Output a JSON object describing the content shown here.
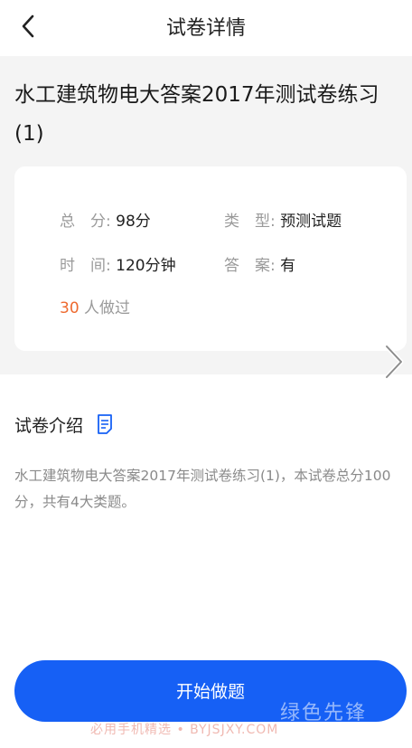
{
  "header": {
    "title": "试卷详情",
    "back_icon": "chevron-left-icon"
  },
  "exam": {
    "title": "水工建筑物电大答案2017年测试卷练习(1)"
  },
  "info": {
    "total_label": "总　分:",
    "total_value": "98分",
    "type_label": "类　型:",
    "type_value": "预测试题",
    "time_label": "时　间:",
    "time_value": "120分钟",
    "answer_label": "答　案:",
    "answer_value": "有",
    "count_value": "30",
    "count_suffix": "人做过"
  },
  "intro": {
    "title": "试卷介绍",
    "icon": "document-icon",
    "text": "水工建筑物电大答案2017年测试卷练习(1)，本试卷总分100分，共有4大类题。"
  },
  "actions": {
    "start_label": "开始做题"
  },
  "watermark": {
    "caption": "必用手机精选 • BYJSJXY.COM",
    "brand": "绿色先锋"
  },
  "colors": {
    "accent": "#1660f5",
    "count": "#ee6a2f",
    "page_bg": "#f4f4f4"
  }
}
